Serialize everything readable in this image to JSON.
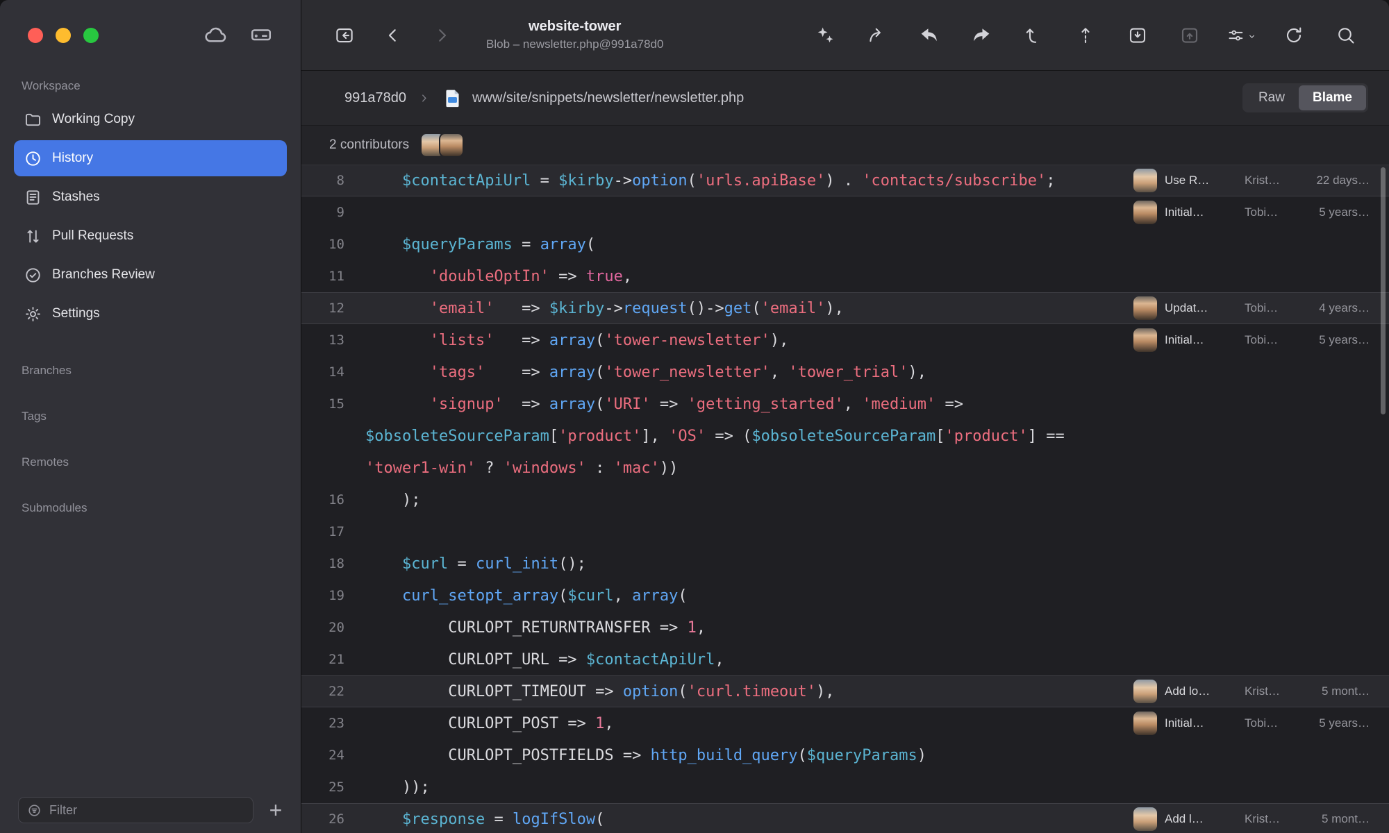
{
  "window": {
    "traffic_lights": [
      {
        "name": "close-button",
        "color": "#ff5f57"
      },
      {
        "name": "minimize-button",
        "color": "#febc2e"
      },
      {
        "name": "zoom-button",
        "color": "#28c840"
      }
    ]
  },
  "sidebar": {
    "header_icons": [
      {
        "name": "cloud-icon"
      },
      {
        "name": "drive-icon"
      }
    ],
    "sections": [
      {
        "label": "Workspace",
        "items": [
          {
            "label": "Working Copy",
            "icon": "folder-icon",
            "selected": false
          },
          {
            "label": "History",
            "icon": "clock-icon",
            "selected": true
          },
          {
            "label": "Stashes",
            "icon": "stashes-icon",
            "selected": false
          },
          {
            "label": "Pull Requests",
            "icon": "pull-request-icon",
            "selected": false
          },
          {
            "label": "Branches Review",
            "icon": "branches-review-icon",
            "selected": false
          },
          {
            "label": "Settings",
            "icon": "gear-icon",
            "selected": false
          }
        ]
      },
      {
        "label": "Branches",
        "items": []
      },
      {
        "label": "Tags",
        "items": []
      },
      {
        "label": "Remotes",
        "items": []
      },
      {
        "label": "Submodules",
        "items": []
      }
    ],
    "filter": {
      "placeholder": "Filter",
      "icon": "filter-icon",
      "add_label": "+"
    }
  },
  "toolbar": {
    "title": "website-tower",
    "subtitle": "Blob – newsletter.php@991a78d0",
    "left_icons": [
      {
        "name": "back-to-working-copy-icon",
        "disabled": false
      },
      {
        "name": "chevron-left-icon",
        "disabled": false
      },
      {
        "name": "chevron-right-icon",
        "disabled": true
      }
    ],
    "right_icons": [
      {
        "name": "quick-actions-icon",
        "disabled": false
      },
      {
        "name": "fetch-icon",
        "disabled": false
      },
      {
        "name": "pull-icon",
        "disabled": false
      },
      {
        "name": "push-icon",
        "disabled": false
      },
      {
        "name": "checkout-icon",
        "disabled": false
      },
      {
        "name": "commit-icon",
        "disabled": false
      },
      {
        "name": "stash-icon",
        "disabled": false
      },
      {
        "name": "apply-stash-icon",
        "disabled": true
      },
      {
        "name": "view-options-icon",
        "disabled": false,
        "chevron": true
      },
      {
        "name": "refresh-icon",
        "disabled": false
      },
      {
        "name": "search-icon",
        "disabled": false
      }
    ]
  },
  "breadcrumb": {
    "commit": "991a78d0",
    "separator_icon": "chevron-separator-icon",
    "file_icon": "php-file-icon",
    "file_path": "www/site/snippets/newsletter/newsletter.php",
    "view_buttons": [
      {
        "label": "Raw",
        "active": false
      },
      {
        "label": "Blame",
        "active": true
      }
    ]
  },
  "contributors": {
    "label": "2 contributors",
    "avatars": [
      "kristian",
      "tobias"
    ]
  },
  "code": {
    "syntax_colors": {
      "variable": "#5bb4d2",
      "function": "#60a7f5",
      "string": "#ec6e7f",
      "keyword": "#e0679e",
      "number": "#ea7a9a",
      "plain": "#dadade"
    },
    "rows": [
      {
        "num": "8",
        "hl": true,
        "blame": {
          "avatar": "kristian",
          "msg": "Use R…",
          "author": "Krist…",
          "date": "22 days…"
        },
        "tokens": [
          [
            "p",
            "    "
          ],
          [
            "v",
            "$contactApiUrl"
          ],
          [
            "p",
            " = "
          ],
          [
            "v",
            "$kirby"
          ],
          [
            "p",
            "->"
          ],
          [
            "f",
            "option"
          ],
          [
            "p",
            "("
          ],
          [
            "s",
            "'urls.apiBase'"
          ],
          [
            "p",
            ") . "
          ],
          [
            "s",
            "'contacts/subscribe'"
          ],
          [
            "p",
            ";"
          ]
        ]
      },
      {
        "num": "9",
        "hl": false,
        "blame": {
          "avatar": "tobias",
          "msg": "Initial…",
          "author": "Tobi…",
          "date": "5 years…"
        },
        "tokens": []
      },
      {
        "num": "10",
        "hl": false,
        "tokens": [
          [
            "p",
            "    "
          ],
          [
            "v",
            "$queryParams"
          ],
          [
            "p",
            " = "
          ],
          [
            "f",
            "array"
          ],
          [
            "p",
            "("
          ]
        ]
      },
      {
        "num": "11",
        "hl": false,
        "tokens": [
          [
            "p",
            "       "
          ],
          [
            "s",
            "'doubleOptIn'"
          ],
          [
            "p",
            " => "
          ],
          [
            "k",
            "true"
          ],
          [
            "p",
            ","
          ]
        ]
      },
      {
        "num": "12",
        "hl": true,
        "blame": {
          "avatar": "tobias",
          "msg": "Updat…",
          "author": "Tobi…",
          "date": "4 years…"
        },
        "tokens": [
          [
            "p",
            "       "
          ],
          [
            "s",
            "'email'"
          ],
          [
            "p",
            "   => "
          ],
          [
            "v",
            "$kirby"
          ],
          [
            "p",
            "->"
          ],
          [
            "f",
            "request"
          ],
          [
            "p",
            "()->"
          ],
          [
            "f",
            "get"
          ],
          [
            "p",
            "("
          ],
          [
            "s",
            "'email'"
          ],
          [
            "p",
            "),"
          ]
        ]
      },
      {
        "num": "13",
        "hl": false,
        "blame": {
          "avatar": "tobias",
          "msg": "Initial…",
          "author": "Tobi…",
          "date": "5 years…"
        },
        "tokens": [
          [
            "p",
            "       "
          ],
          [
            "s",
            "'lists'"
          ],
          [
            "p",
            "   => "
          ],
          [
            "f",
            "array"
          ],
          [
            "p",
            "("
          ],
          [
            "s",
            "'tower-newsletter'"
          ],
          [
            "p",
            "),"
          ]
        ]
      },
      {
        "num": "14",
        "hl": false,
        "tokens": [
          [
            "p",
            "       "
          ],
          [
            "s",
            "'tags'"
          ],
          [
            "p",
            "    => "
          ],
          [
            "f",
            "array"
          ],
          [
            "p",
            "("
          ],
          [
            "s",
            "'tower_newsletter'"
          ],
          [
            "p",
            ", "
          ],
          [
            "s",
            "'tower_trial'"
          ],
          [
            "p",
            "),"
          ]
        ]
      },
      {
        "num": "15",
        "hl": false,
        "tokens": [
          [
            "p",
            "       "
          ],
          [
            "s",
            "'signup'"
          ],
          [
            "p",
            "  => "
          ],
          [
            "f",
            "array"
          ],
          [
            "p",
            "("
          ],
          [
            "s",
            "'URI'"
          ],
          [
            "p",
            " => "
          ],
          [
            "s",
            "'getting_started'"
          ],
          [
            "p",
            ", "
          ],
          [
            "s",
            "'medium'"
          ],
          [
            "p",
            " =>"
          ]
        ]
      },
      {
        "num": "",
        "hl": false,
        "tokens": [
          [
            "v",
            "$obsoleteSourceParam"
          ],
          [
            "p",
            "["
          ],
          [
            "s",
            "'product'"
          ],
          [
            "p",
            "], "
          ],
          [
            "s",
            "'OS'"
          ],
          [
            "p",
            " => ("
          ],
          [
            "v",
            "$obsoleteSourceParam"
          ],
          [
            "p",
            "["
          ],
          [
            "s",
            "'product'"
          ],
          [
            "p",
            "] =="
          ]
        ]
      },
      {
        "num": "",
        "hl": false,
        "tokens": [
          [
            "s",
            "'tower1-win'"
          ],
          [
            "p",
            " ? "
          ],
          [
            "s",
            "'windows'"
          ],
          [
            "p",
            " : "
          ],
          [
            "s",
            "'mac'"
          ],
          [
            "p",
            "))"
          ]
        ]
      },
      {
        "num": "16",
        "hl": false,
        "tokens": [
          [
            "p",
            "    );"
          ]
        ]
      },
      {
        "num": "17",
        "hl": false,
        "tokens": []
      },
      {
        "num": "18",
        "hl": false,
        "tokens": [
          [
            "p",
            "    "
          ],
          [
            "v",
            "$curl"
          ],
          [
            "p",
            " = "
          ],
          [
            "f",
            "curl_init"
          ],
          [
            "p",
            "();"
          ]
        ]
      },
      {
        "num": "19",
        "hl": false,
        "tokens": [
          [
            "p",
            "    "
          ],
          [
            "f",
            "curl_setopt_array"
          ],
          [
            "p",
            "("
          ],
          [
            "v",
            "$curl"
          ],
          [
            "p",
            ", "
          ],
          [
            "f",
            "array"
          ],
          [
            "p",
            "("
          ]
        ]
      },
      {
        "num": "20",
        "hl": false,
        "tokens": [
          [
            "p",
            "         CURLOPT_RETURNTRANSFER => "
          ],
          [
            "n",
            "1"
          ],
          [
            "p",
            ","
          ]
        ]
      },
      {
        "num": "21",
        "hl": false,
        "tokens": [
          [
            "p",
            "         CURLOPT_URL => "
          ],
          [
            "v",
            "$contactApiUrl"
          ],
          [
            "p",
            ","
          ]
        ]
      },
      {
        "num": "22",
        "hl": true,
        "blame": {
          "avatar": "kristian",
          "msg": "Add lo…",
          "author": "Krist…",
          "date": "5 mont…"
        },
        "tokens": [
          [
            "p",
            "         CURLOPT_TIMEOUT => "
          ],
          [
            "f",
            "option"
          ],
          [
            "p",
            "("
          ],
          [
            "s",
            "'curl.timeout'"
          ],
          [
            "p",
            "),"
          ]
        ]
      },
      {
        "num": "23",
        "hl": false,
        "blame": {
          "avatar": "tobias",
          "msg": "Initial…",
          "author": "Tobi…",
          "date": "5 years…"
        },
        "tokens": [
          [
            "p",
            "         CURLOPT_POST => "
          ],
          [
            "n",
            "1"
          ],
          [
            "p",
            ","
          ]
        ]
      },
      {
        "num": "24",
        "hl": false,
        "tokens": [
          [
            "p",
            "         CURLOPT_POSTFIELDS => "
          ],
          [
            "f",
            "http_build_query"
          ],
          [
            "p",
            "("
          ],
          [
            "v",
            "$queryParams"
          ],
          [
            "p",
            ")"
          ]
        ]
      },
      {
        "num": "25",
        "hl": false,
        "tokens": [
          [
            "p",
            "    ));"
          ]
        ]
      },
      {
        "num": "26",
        "hl": true,
        "blame": {
          "avatar": "kristian",
          "msg": "Add l…",
          "author": "Krist…",
          "date": "5 mont…"
        },
        "tokens": [
          [
            "p",
            "    "
          ],
          [
            "v",
            "$response"
          ],
          [
            "p",
            " = "
          ],
          [
            "f",
            "logIfSlow"
          ],
          [
            "p",
            "("
          ]
        ]
      }
    ]
  }
}
